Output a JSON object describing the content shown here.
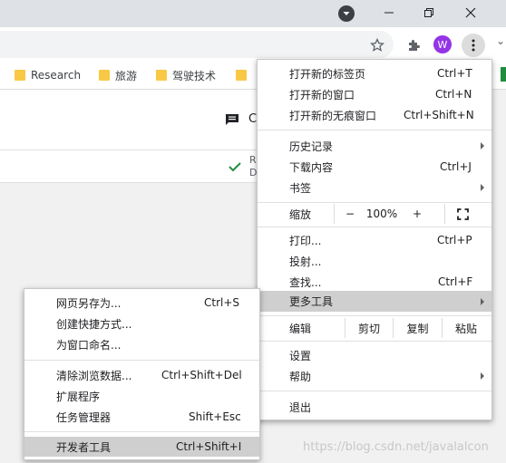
{
  "bookmarks": [
    "Research",
    "旅游",
    "驾驶技术"
  ],
  "page": {
    "header_fragment": "C",
    "sub_fragment_1": "R",
    "sub_fragment_2": "D"
  },
  "avatar_letter": "W",
  "main_menu": {
    "new_tab": {
      "label": "打开新的标签页",
      "shortcut": "Ctrl+T"
    },
    "new_window": {
      "label": "打开新的窗口",
      "shortcut": "Ctrl+N"
    },
    "incognito": {
      "label": "打开新的无痕窗口",
      "shortcut": "Ctrl+Shift+N"
    },
    "history": {
      "label": "历史记录"
    },
    "downloads": {
      "label": "下载内容",
      "shortcut": "Ctrl+J"
    },
    "bookmarks": {
      "label": "书签"
    },
    "zoom": {
      "label": "缩放",
      "minus": "−",
      "value": "100%",
      "plus": "+"
    },
    "print": {
      "label": "打印...",
      "shortcut": "Ctrl+P"
    },
    "cast": {
      "label": "投射..."
    },
    "find": {
      "label": "查找...",
      "shortcut": "Ctrl+F"
    },
    "more_tools": {
      "label": "更多工具"
    },
    "edit": {
      "label": "编辑",
      "cut": "剪切",
      "copy": "复制",
      "paste": "粘贴"
    },
    "settings": {
      "label": "设置"
    },
    "help": {
      "label": "帮助"
    },
    "exit": {
      "label": "退出"
    }
  },
  "submenu": {
    "save_page": {
      "label": "网页另存为...",
      "shortcut": "Ctrl+S"
    },
    "create_shortcut": {
      "label": "创建快捷方式..."
    },
    "name_window": {
      "label": "为窗口命名..."
    },
    "clear_data": {
      "label": "清除浏览数据...",
      "shortcut": "Ctrl+Shift+Del"
    },
    "extensions": {
      "label": "扩展程序"
    },
    "task_manager": {
      "label": "任务管理器",
      "shortcut": "Shift+Esc"
    },
    "dev_tools": {
      "label": "开发者工具",
      "shortcut": "Ctrl+Shift+I"
    }
  },
  "watermark": "https://blog.csdn.net/javalalcon",
  "colors": {
    "title_bar": "#dee1e6",
    "highlight": "#cfcfcf",
    "avatar": "#9334e6",
    "folder": "#f9c846",
    "check": "#1e8e3e"
  }
}
